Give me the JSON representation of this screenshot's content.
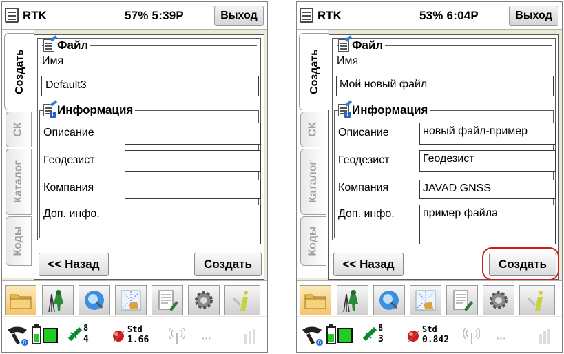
{
  "screens": [
    {
      "title_bar": {
        "app_title": "RTK",
        "battery_time": "57% 5:39P",
        "exit_label": "Выход"
      },
      "tabs": [
        "Создать",
        "СК",
        "Каталог",
        "Коды"
      ],
      "file_group": {
        "title": "Файл",
        "name_label": "Имя",
        "name_value": "Default3"
      },
      "info_group": {
        "title": "Информация",
        "description_label": "Описание",
        "description_value": "",
        "surveyor_label": "Геодезист",
        "surveyor_value": "",
        "company_label": "Компания",
        "company_value": "",
        "extra_label": "Доп. инфо.",
        "extra_value": ""
      },
      "buttons": {
        "back": "<< Назад",
        "create": "Создать"
      },
      "toolbar_icons": [
        "folder-icon",
        "surveyor-icon",
        "globe-icon",
        "map-icon",
        "document-pen-icon",
        "gear-icon",
        "info-icon"
      ],
      "status": {
        "sat_count_top": "8",
        "sat_count_bottom": "4",
        "std_label": "Std",
        "std_value": "1.66"
      }
    },
    {
      "title_bar": {
        "app_title": "RTK",
        "battery_time": "53% 6:04P",
        "exit_label": "Выход"
      },
      "tabs": [
        "Создать",
        "СК",
        "Каталог",
        "Коды"
      ],
      "file_group": {
        "title": "Файл",
        "name_label": "Имя",
        "name_value": "Мой новый файл"
      },
      "info_group": {
        "title": "Информация",
        "description_label": "Описание",
        "description_value": "новый файл-пример",
        "surveyor_label": "Геодезист",
        "surveyor_value": "Геодезист",
        "company_label": "Компания",
        "company_value": "JAVAD GNSS",
        "extra_label": "Доп. инфо.",
        "extra_value": "пример файла"
      },
      "buttons": {
        "back": "<< Назад",
        "create": "Создать"
      },
      "toolbar_icons": [
        "folder-icon",
        "surveyor-icon",
        "globe-icon",
        "map-icon",
        "document-pen-icon",
        "gear-icon",
        "info-icon"
      ],
      "status": {
        "sat_count_top": "8",
        "sat_count_bottom": "3",
        "std_label": "Std",
        "std_value": "0.842"
      }
    }
  ],
  "colors": {
    "highlight": "#d11a1a",
    "battery_green": "#22cc22",
    "std_red": "#d11a1a"
  }
}
